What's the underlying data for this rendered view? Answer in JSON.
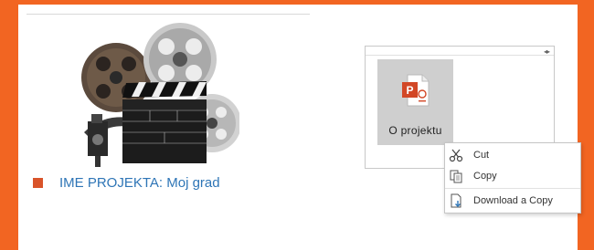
{
  "project": {
    "title": "IME PROJEKTA: Moj grad",
    "image_icon": "film-reels-clapperboard-camera-illustration"
  },
  "file_panel": {
    "file_name": "O projektu",
    "file_icon": "powerpoint-file-icon",
    "toggle_icon": "expand-arrows-icon"
  },
  "context_menu": {
    "items": [
      {
        "label": "Cut",
        "icon": "scissors-icon"
      },
      {
        "label": "Copy",
        "icon": "copy-icon"
      },
      {
        "label": "Download a Copy",
        "icon": "download-icon"
      }
    ]
  },
  "colors": {
    "frame": "#f26522",
    "bullet": "#d9542a",
    "link": "#2e75b6",
    "tile": "#cfcfcf",
    "powerpoint": "#d24726"
  }
}
